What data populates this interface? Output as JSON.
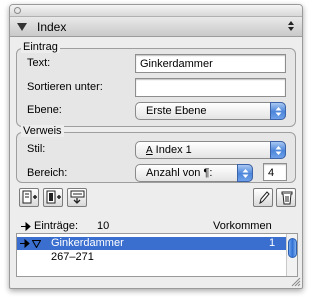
{
  "palette": {
    "title": "Index"
  },
  "entry": {
    "group_label": "Eintrag",
    "text_label": "Text:",
    "text_value": "Ginkerdammer",
    "sort_label": "Sortieren unter:",
    "sort_value": "",
    "level_label": "Ebene:",
    "level_value": "Erste Ebene"
  },
  "reference": {
    "group_label": "Verweis",
    "style_label": "Stil:",
    "style_value": "Index 1",
    "range_label": "Bereich:",
    "range_value": "Anzahl von ¶:",
    "range_count": "4"
  },
  "toolbar": {
    "icons": [
      "add-entry-icon",
      "add-reversed-entry-icon",
      "find-next-icon",
      "edit-icon",
      "trash-icon"
    ]
  },
  "list": {
    "entries_label": "Einträge:",
    "entries_count": "10",
    "occurrences_label": "Vorkommen",
    "rows": [
      {
        "label": "Ginkerdammer",
        "count": "1",
        "selected": true
      },
      {
        "label": "267–271",
        "count": "",
        "selected": false
      }
    ]
  },
  "colors": {
    "selection": "#3a6fd0",
    "popup_arrow": "#4b85da",
    "panel_bg": "#ededed"
  }
}
